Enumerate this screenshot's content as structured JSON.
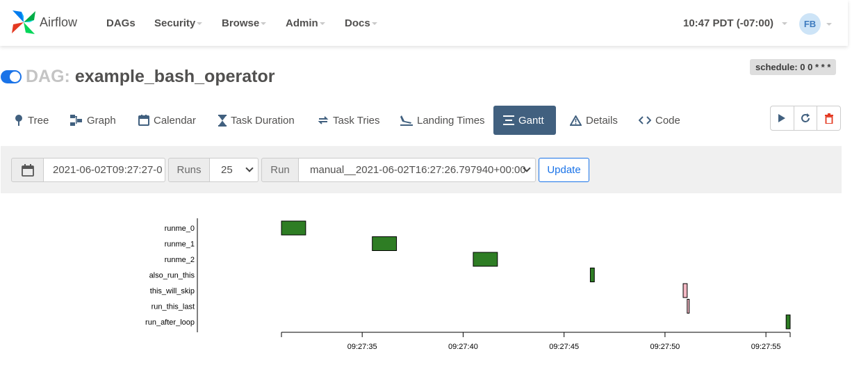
{
  "navbar": {
    "brand": "Airflow",
    "items": [
      "DAGs",
      "Security",
      "Browse",
      "Admin",
      "Docs"
    ],
    "clock": "10:47 PDT (-07:00)",
    "avatar": "FB"
  },
  "dag": {
    "prefix": "DAG:",
    "name": "example_bash_operator",
    "schedule": "schedule: 0 0 * * *",
    "paused": false
  },
  "tabs": [
    {
      "label": "Tree",
      "icon": "tree-icon"
    },
    {
      "label": "Graph",
      "icon": "graph-icon"
    },
    {
      "label": "Calendar",
      "icon": "calendar-icon"
    },
    {
      "label": "Task Duration",
      "icon": "hourglass-icon"
    },
    {
      "label": "Task Tries",
      "icon": "retry-icon"
    },
    {
      "label": "Landing Times",
      "icon": "plane-landing-icon"
    },
    {
      "label": "Gantt",
      "icon": "gantt-icon",
      "active": true
    },
    {
      "label": "Details",
      "icon": "warning-icon"
    },
    {
      "label": "Code",
      "icon": "code-icon"
    }
  ],
  "actions": [
    "trigger-dag",
    "refresh",
    "delete-dag"
  ],
  "filters": {
    "date_value": "2021-06-02T09:27:27-0",
    "runs_label": "Runs",
    "runs_value": "25",
    "run_label": "Run",
    "run_value": "manual__2021-06-02T16:27:26.797940+00:00",
    "update_label": "Update"
  },
  "chart_data": {
    "type": "gantt",
    "tasks": [
      {
        "name": "runme_0",
        "start": "09:27:31.0",
        "end": "09:27:32.2",
        "state": "success"
      },
      {
        "name": "runme_1",
        "start": "09:27:35.5",
        "end": "09:27:36.7",
        "state": "success"
      },
      {
        "name": "runme_2",
        "start": "09:27:40.5",
        "end": "09:27:41.7",
        "state": "success"
      },
      {
        "name": "also_run_this",
        "start": "09:27:46.3",
        "end": "09:27:46.5",
        "state": "success"
      },
      {
        "name": "this_will_skip",
        "start": "09:27:50.9",
        "end": "09:27:51.1",
        "state": "skipped"
      },
      {
        "name": "run_this_last",
        "start": "09:27:51.1",
        "end": "09:27:51.2",
        "state": "skipped"
      },
      {
        "name": "run_after_loop",
        "start": "09:27:56.0",
        "end": "09:27:56.2",
        "state": "success"
      }
    ],
    "x_ticks": [
      "09:27:35",
      "09:27:40",
      "09:27:45",
      "09:27:50",
      "09:27:55"
    ],
    "xlim": [
      "09:27:31.0",
      "09:27:56.2"
    ],
    "colors": {
      "success": "#2e7d24",
      "skipped": "#f4b8c4"
    }
  }
}
